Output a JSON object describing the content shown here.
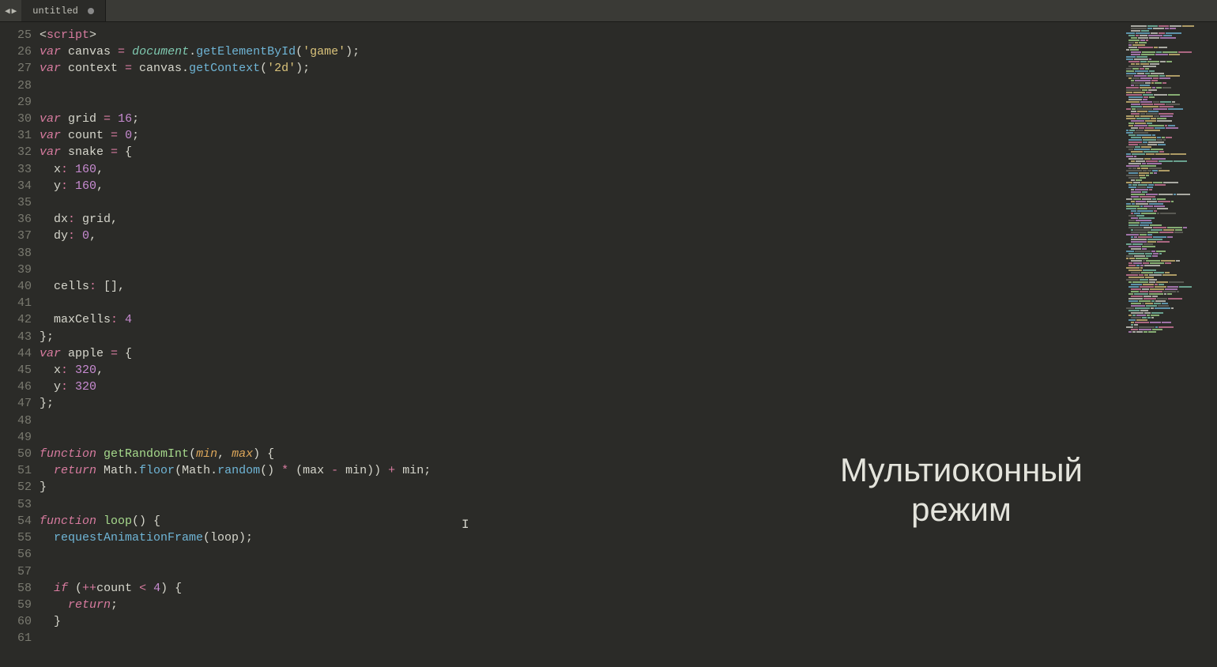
{
  "tab": {
    "title": "untitled",
    "modified": true
  },
  "nav": {
    "back": "◀",
    "forward": "▶"
  },
  "overlay": {
    "line1": "Мультиоконный",
    "line2": "режим"
  },
  "gutter": {
    "start": 25,
    "end": 61
  },
  "cursor": {
    "glyph": "I"
  },
  "code_lines": [
    {
      "num": 25,
      "tokens": [
        [
          "p",
          "<"
        ],
        [
          "tag",
          "script"
        ],
        [
          "p",
          ">"
        ]
      ]
    },
    {
      "num": 26,
      "tokens": [
        [
          "k",
          "var"
        ],
        [
          "p",
          " canvas "
        ],
        [
          "op",
          "="
        ],
        [
          "p",
          " "
        ],
        [
          "sp",
          "document"
        ],
        [
          "p",
          "."
        ],
        [
          "fn",
          "getElementById"
        ],
        [
          "p",
          "("
        ],
        [
          "s",
          "'game'"
        ],
        [
          "p",
          ");"
        ]
      ]
    },
    {
      "num": 27,
      "tokens": [
        [
          "k",
          "var"
        ],
        [
          "p",
          " context "
        ],
        [
          "op",
          "="
        ],
        [
          "p",
          " canvas."
        ],
        [
          "fn",
          "getContext"
        ],
        [
          "p",
          "("
        ],
        [
          "s",
          "'2d'"
        ],
        [
          "p",
          ");"
        ]
      ]
    },
    {
      "num": 28,
      "tokens": []
    },
    {
      "num": 29,
      "tokens": []
    },
    {
      "num": 30,
      "tokens": [
        [
          "k",
          "var"
        ],
        [
          "p",
          " grid "
        ],
        [
          "op",
          "="
        ],
        [
          "p",
          " "
        ],
        [
          "n",
          "16"
        ],
        [
          "p",
          ";"
        ]
      ]
    },
    {
      "num": 31,
      "tokens": [
        [
          "k",
          "var"
        ],
        [
          "p",
          " count "
        ],
        [
          "op",
          "="
        ],
        [
          "p",
          " "
        ],
        [
          "n",
          "0"
        ],
        [
          "p",
          ";"
        ]
      ]
    },
    {
      "num": 32,
      "tokens": [
        [
          "k",
          "var"
        ],
        [
          "p",
          " snake "
        ],
        [
          "op",
          "="
        ],
        [
          "p",
          " {"
        ]
      ]
    },
    {
      "num": 33,
      "tokens": [
        [
          "p",
          "  x"
        ],
        [
          "op",
          ":"
        ],
        [
          "p",
          " "
        ],
        [
          "n",
          "160"
        ],
        [
          "p",
          ","
        ]
      ]
    },
    {
      "num": 34,
      "tokens": [
        [
          "p",
          "  y"
        ],
        [
          "op",
          ":"
        ],
        [
          "p",
          " "
        ],
        [
          "n",
          "160"
        ],
        [
          "p",
          ","
        ]
      ]
    },
    {
      "num": 35,
      "tokens": []
    },
    {
      "num": 36,
      "tokens": [
        [
          "p",
          "  dx"
        ],
        [
          "op",
          ":"
        ],
        [
          "p",
          " grid,"
        ]
      ]
    },
    {
      "num": 37,
      "tokens": [
        [
          "p",
          "  dy"
        ],
        [
          "op",
          ":"
        ],
        [
          "p",
          " "
        ],
        [
          "n",
          "0"
        ],
        [
          "p",
          ","
        ]
      ]
    },
    {
      "num": 38,
      "tokens": []
    },
    {
      "num": 39,
      "tokens": []
    },
    {
      "num": 40,
      "tokens": [
        [
          "p",
          "  cells"
        ],
        [
          "op",
          ":"
        ],
        [
          "p",
          " [],"
        ]
      ]
    },
    {
      "num": 41,
      "tokens": []
    },
    {
      "num": 42,
      "tokens": [
        [
          "p",
          "  maxCells"
        ],
        [
          "op",
          ":"
        ],
        [
          "p",
          " "
        ],
        [
          "n",
          "4"
        ]
      ]
    },
    {
      "num": 43,
      "tokens": [
        [
          "p",
          "};"
        ]
      ]
    },
    {
      "num": 44,
      "tokens": [
        [
          "k",
          "var"
        ],
        [
          "p",
          " apple "
        ],
        [
          "op",
          "="
        ],
        [
          "p",
          " {"
        ]
      ]
    },
    {
      "num": 45,
      "tokens": [
        [
          "p",
          "  x"
        ],
        [
          "op",
          ":"
        ],
        [
          "p",
          " "
        ],
        [
          "n",
          "320"
        ],
        [
          "p",
          ","
        ]
      ]
    },
    {
      "num": 46,
      "tokens": [
        [
          "p",
          "  y"
        ],
        [
          "op",
          ":"
        ],
        [
          "p",
          " "
        ],
        [
          "n",
          "320"
        ]
      ]
    },
    {
      "num": 47,
      "tokens": [
        [
          "p",
          "};"
        ]
      ]
    },
    {
      "num": 48,
      "tokens": []
    },
    {
      "num": 49,
      "tokens": []
    },
    {
      "num": 50,
      "tokens": [
        [
          "k",
          "function"
        ],
        [
          "p",
          " "
        ],
        [
          "fnd",
          "getRandomInt"
        ],
        [
          "p",
          "("
        ],
        [
          "par",
          "min"
        ],
        [
          "p",
          ", "
        ],
        [
          "par",
          "max"
        ],
        [
          "p",
          ") {"
        ]
      ]
    },
    {
      "num": 51,
      "tokens": [
        [
          "p",
          "  "
        ],
        [
          "k",
          "return"
        ],
        [
          "p",
          " Math."
        ],
        [
          "fn",
          "floor"
        ],
        [
          "p",
          "(Math."
        ],
        [
          "fn",
          "random"
        ],
        [
          "p",
          "() "
        ],
        [
          "op",
          "*"
        ],
        [
          "p",
          " (max "
        ],
        [
          "op",
          "-"
        ],
        [
          "p",
          " min)) "
        ],
        [
          "op",
          "+"
        ],
        [
          "p",
          " min;"
        ]
      ]
    },
    {
      "num": 52,
      "tokens": [
        [
          "p",
          "}"
        ]
      ]
    },
    {
      "num": 53,
      "tokens": []
    },
    {
      "num": 54,
      "tokens": [
        [
          "k",
          "function"
        ],
        [
          "p",
          " "
        ],
        [
          "fnd",
          "loop"
        ],
        [
          "p",
          "() {"
        ]
      ]
    },
    {
      "num": 55,
      "tokens": [
        [
          "p",
          "  "
        ],
        [
          "fn",
          "requestAnimationFrame"
        ],
        [
          "p",
          "(loop);"
        ]
      ]
    },
    {
      "num": 56,
      "tokens": []
    },
    {
      "num": 57,
      "tokens": []
    },
    {
      "num": 58,
      "tokens": [
        [
          "p",
          "  "
        ],
        [
          "k",
          "if"
        ],
        [
          "p",
          " ("
        ],
        [
          "op",
          "++"
        ],
        [
          "p",
          "count "
        ],
        [
          "op",
          "<"
        ],
        [
          "p",
          " "
        ],
        [
          "n",
          "4"
        ],
        [
          "p",
          ") {"
        ]
      ]
    },
    {
      "num": 59,
      "tokens": [
        [
          "p",
          "    "
        ],
        [
          "k",
          "return"
        ],
        [
          "p",
          ";"
        ]
      ]
    },
    {
      "num": 60,
      "tokens": [
        [
          "p",
          "  }"
        ]
      ]
    },
    {
      "num": 61,
      "tokens": []
    }
  ],
  "minimap_palette": [
    "#d77b9f",
    "#6fb5d6",
    "#d9c27a",
    "#c78bd1",
    "#a6d98c",
    "#7fc9b0",
    "#d6d6cc",
    "#6a6a62"
  ]
}
